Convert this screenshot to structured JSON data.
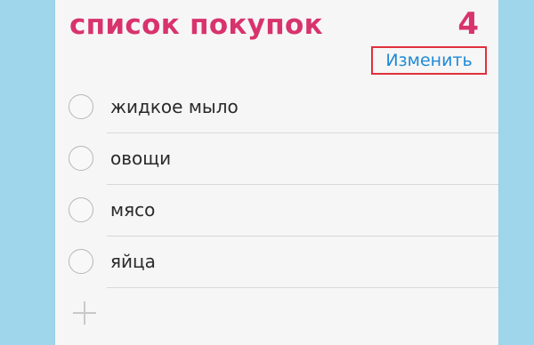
{
  "list": {
    "title": "список покупок",
    "count": "4",
    "edit_label": "Изменить",
    "items": [
      {
        "label": "жидкое мыло",
        "checked": false
      },
      {
        "label": "овощи",
        "checked": false
      },
      {
        "label": "мясо",
        "checked": false
      },
      {
        "label": "яйца",
        "checked": false
      }
    ],
    "add_icon": "plus-icon"
  },
  "colors": {
    "background": "#9fd6ec",
    "title": "#d8336d",
    "link": "#1f8ad6",
    "highlight_border": "#e0303c"
  }
}
